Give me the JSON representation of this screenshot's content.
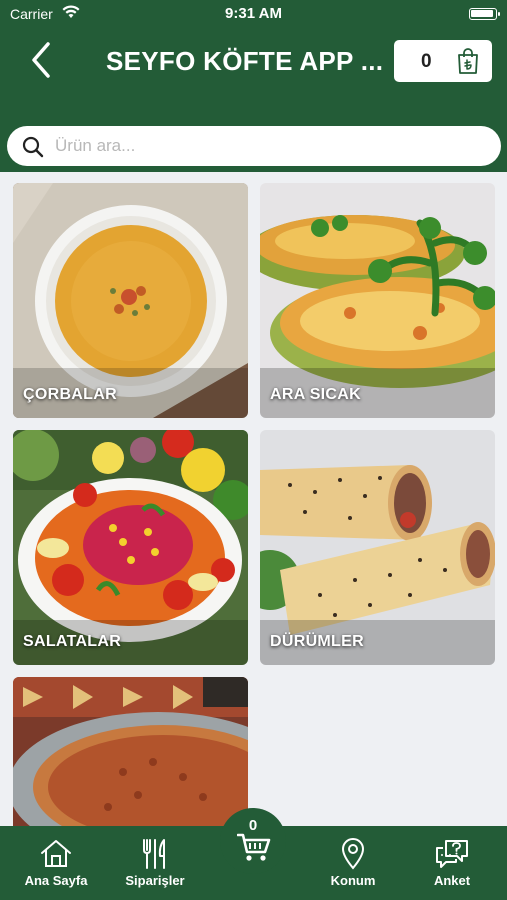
{
  "status_bar": {
    "carrier": "Carrier",
    "time": "9:31 AM"
  },
  "header": {
    "title": "SEYFO KÖFTE APP ...",
    "cart_count": "0"
  },
  "search": {
    "placeholder": "Ürün ara..."
  },
  "categories": [
    {
      "label": "ÇORBALAR"
    },
    {
      "label": "ARA SICAK"
    },
    {
      "label": "SALATALAR"
    },
    {
      "label": "DÜRÜMLER"
    },
    {
      "label": ""
    }
  ],
  "tab_bar": {
    "home": "Ana Sayfa",
    "orders": "Siparişler",
    "cart_count": "0",
    "location": "Konum",
    "survey": "Anket"
  },
  "colors": {
    "brand_green": "#235c37"
  }
}
